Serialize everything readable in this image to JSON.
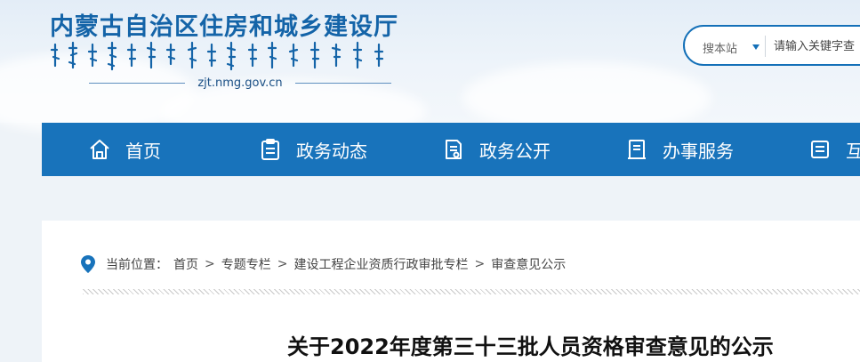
{
  "header": {
    "site_title": "内蒙古自治区住房和城乡建设厅",
    "domain": "zjt.nmg.gov.cn",
    "mongolian_script_icon": "mongolian-script-title"
  },
  "search": {
    "scope_label": "搜本站",
    "placeholder": "请输入关键字查",
    "caret_icon": "caret-down-icon",
    "accent_color": "#1470b8"
  },
  "nav": {
    "background_color": "#1873bb",
    "items": [
      {
        "label": "首页",
        "icon": "home-icon"
      },
      {
        "label": "政务动态",
        "icon": "clipboard-icon"
      },
      {
        "label": "政务公开",
        "icon": "document-icon"
      },
      {
        "label": "办事服务",
        "icon": "form-icon"
      },
      {
        "label": "互",
        "icon": "interaction-icon"
      }
    ]
  },
  "breadcrumb": {
    "icon": "location-pin-icon",
    "prefix": "当前位置：",
    "separator": ">",
    "items": [
      "首页",
      "专题专栏",
      "建设工程企业资质行政审批专栏",
      "审查意见公示"
    ]
  },
  "article": {
    "title": "关于2022年度第三十三批人员资格审查意见的公示"
  }
}
